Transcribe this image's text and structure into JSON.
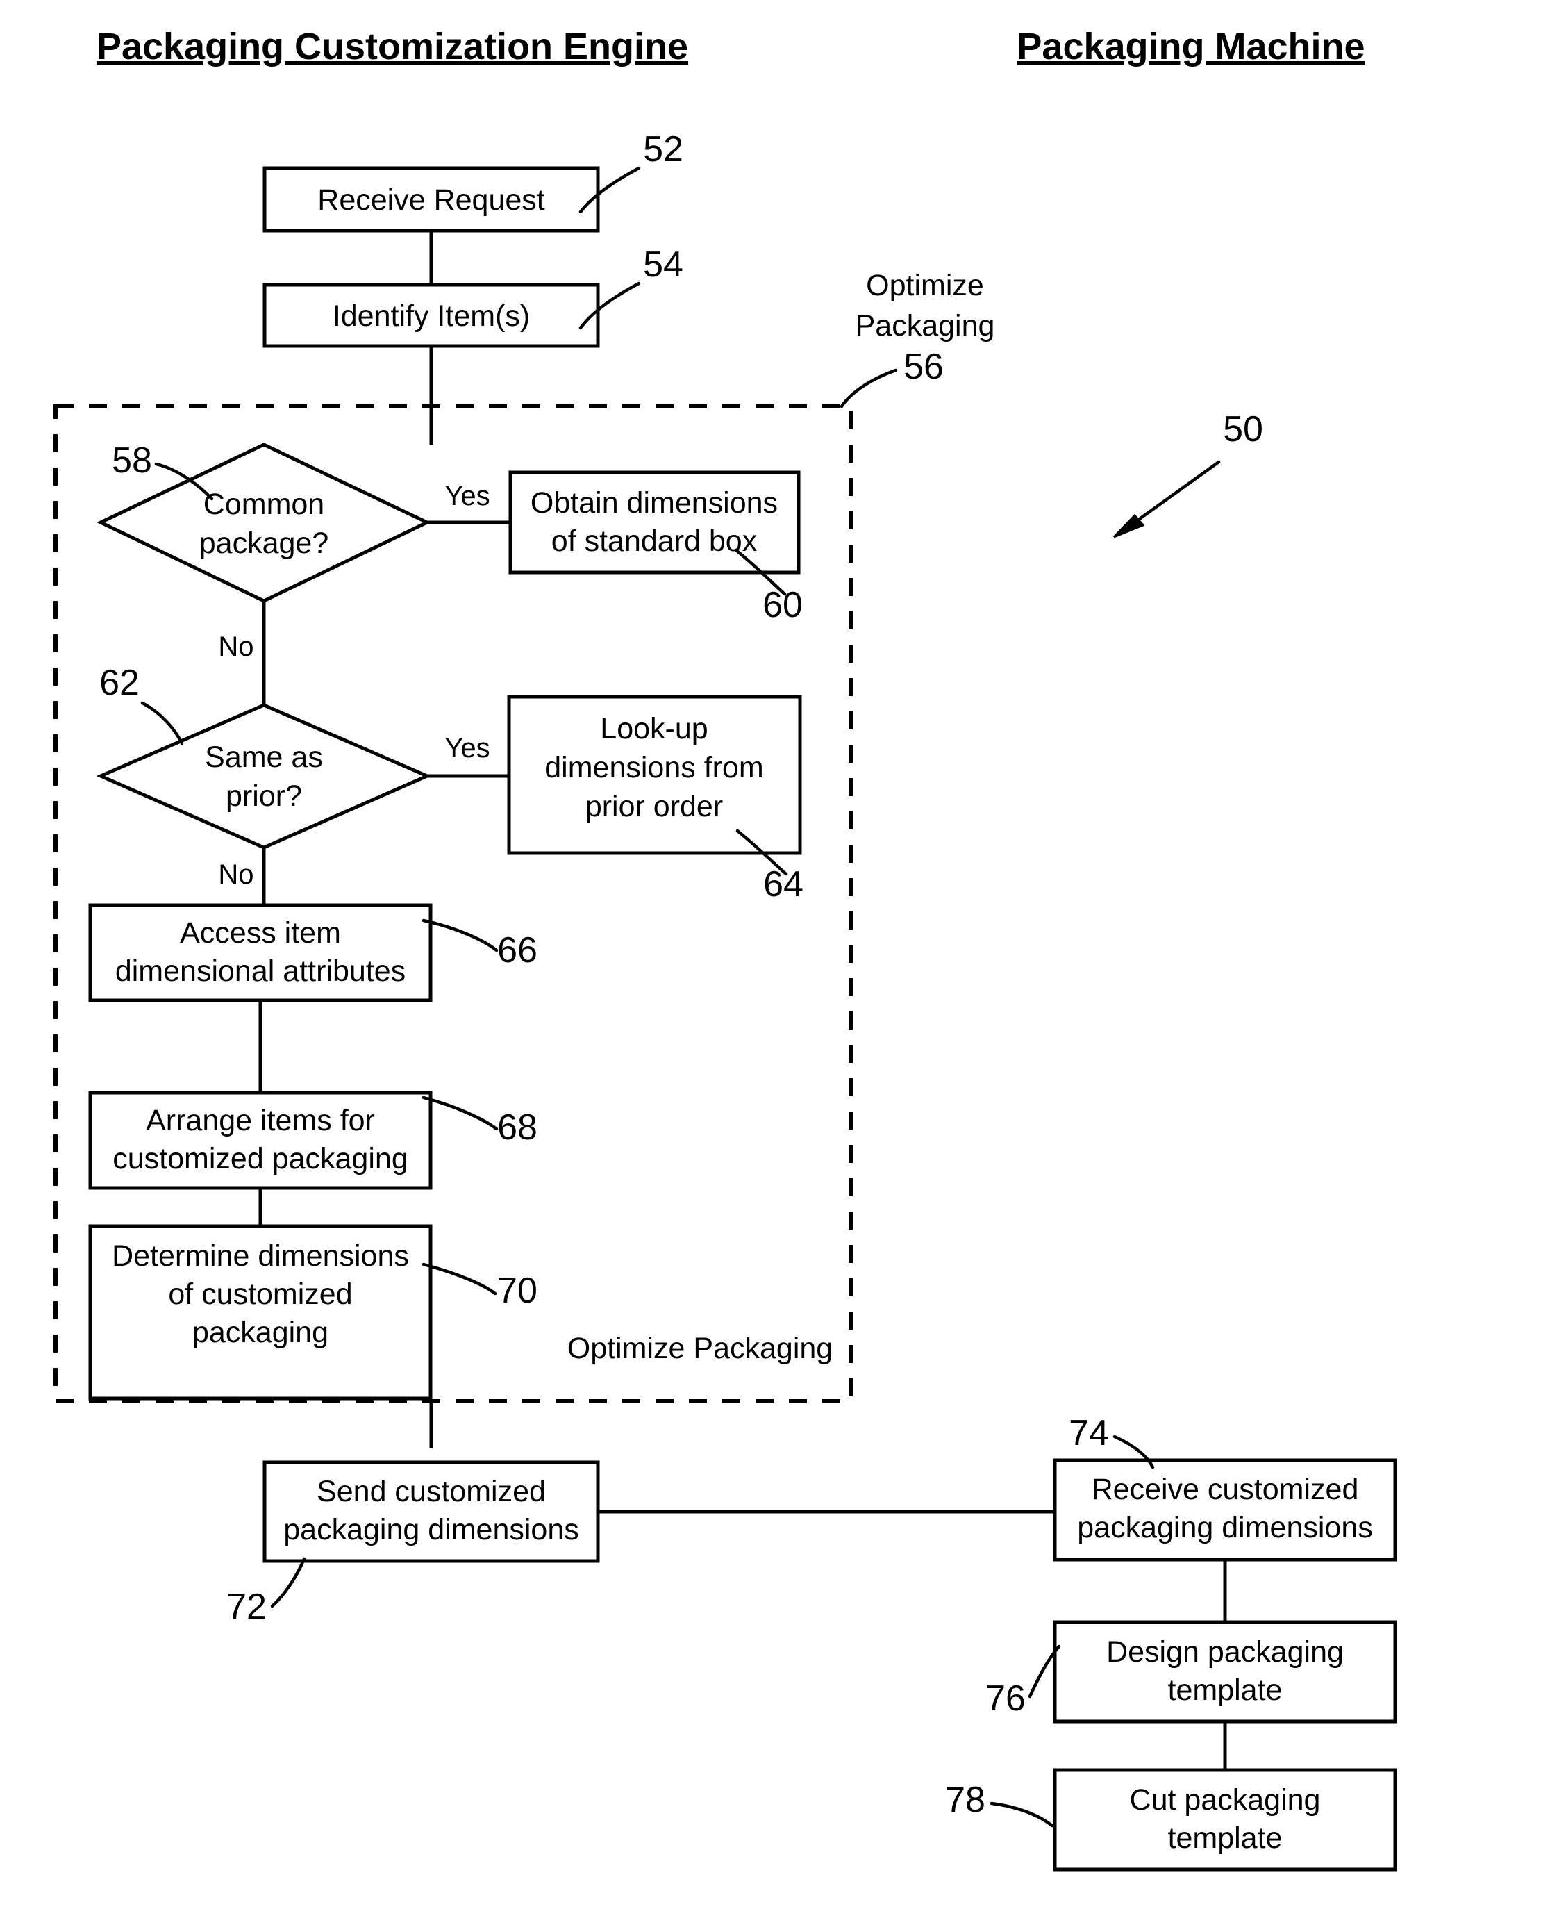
{
  "figure": {
    "reference_numeral": "50",
    "lanes": [
      {
        "id": "engine",
        "title": "Packaging Customization Engine"
      },
      {
        "id": "machine",
        "title": "Packaging Machine"
      }
    ],
    "group": {
      "label_above": "Optimize\nPackaging",
      "label_above_line1": "Optimize",
      "label_above_line2": "Packaging",
      "reference_numeral": "56",
      "caption_inside": "Optimize Packaging"
    },
    "nodes": [
      {
        "id": "n52",
        "ref": "52",
        "shape": "process",
        "lane": "engine",
        "lines": [
          "Receive Request"
        ]
      },
      {
        "id": "n54",
        "ref": "54",
        "shape": "process",
        "lane": "engine",
        "lines": [
          "Identify Item(s)"
        ]
      },
      {
        "id": "n58",
        "ref": "58",
        "shape": "decision",
        "lane": "engine",
        "lines": [
          "Common",
          "package?"
        ]
      },
      {
        "id": "n60",
        "ref": "60",
        "shape": "process",
        "lane": "engine",
        "lines": [
          "Obtain dimensions",
          "of standard box"
        ]
      },
      {
        "id": "n62",
        "ref": "62",
        "shape": "decision",
        "lane": "engine",
        "lines": [
          "Same as",
          "prior?"
        ]
      },
      {
        "id": "n64",
        "ref": "64",
        "shape": "process",
        "lane": "engine",
        "lines": [
          "Look-up",
          "dimensions from",
          "prior order"
        ]
      },
      {
        "id": "n66",
        "ref": "66",
        "shape": "process",
        "lane": "engine",
        "lines": [
          "Access item",
          "dimensional attributes"
        ]
      },
      {
        "id": "n68",
        "ref": "68",
        "shape": "process",
        "lane": "engine",
        "lines": [
          "Arrange items for",
          "customized packaging"
        ]
      },
      {
        "id": "n70",
        "ref": "70",
        "shape": "process",
        "lane": "engine",
        "lines": [
          "Determine dimensions",
          "of customized",
          "packaging"
        ]
      },
      {
        "id": "n72",
        "ref": "72",
        "shape": "process",
        "lane": "engine",
        "lines": [
          "Send customized",
          "packaging dimensions"
        ]
      },
      {
        "id": "n74",
        "ref": "74",
        "shape": "process",
        "lane": "machine",
        "lines": [
          "Receive customized",
          "packaging dimensions"
        ]
      },
      {
        "id": "n76",
        "ref": "76",
        "shape": "process",
        "lane": "machine",
        "lines": [
          "Design packaging",
          "template"
        ]
      },
      {
        "id": "n78",
        "ref": "78",
        "shape": "process",
        "lane": "machine",
        "lines": [
          "Cut packaging",
          "template"
        ]
      }
    ],
    "edge_labels": {
      "yes_58": "Yes",
      "no_58": "No",
      "yes_62": "Yes",
      "no_62": "No"
    },
    "node_text": {
      "n52_l1": "Receive Request",
      "n54_l1": "Identify Item(s)",
      "n58_l1": "Common",
      "n58_l2": "package?",
      "n60_l1": "Obtain dimensions",
      "n60_l2": "of standard box",
      "n62_l1": "Same as",
      "n62_l2": "prior?",
      "n64_l1": "Look-up",
      "n64_l2": "dimensions from",
      "n64_l3": "prior order",
      "n66_l1": "Access item",
      "n66_l2": "dimensional attributes",
      "n68_l1": "Arrange items for",
      "n68_l2": "customized packaging",
      "n70_l1": "Determine dimensions",
      "n70_l2": "of customized",
      "n70_l3": "packaging",
      "n72_l1": "Send customized",
      "n72_l2": "packaging dimensions",
      "n74_l1": "Receive customized",
      "n74_l2": "packaging dimensions",
      "n76_l1": "Design packaging",
      "n76_l2": "template",
      "n78_l1": "Cut packaging",
      "n78_l2": "template"
    },
    "ref_numbers": {
      "r50": "50",
      "r52": "52",
      "r54": "54",
      "r56": "56",
      "r58": "58",
      "r60": "60",
      "r62": "62",
      "r64": "64",
      "r66": "66",
      "r68": "68",
      "r70": "70",
      "r72": "72",
      "r74": "74",
      "r76": "76",
      "r78": "78"
    },
    "colors": {
      "ink": "#000000",
      "paper": "#ffffff"
    }
  }
}
